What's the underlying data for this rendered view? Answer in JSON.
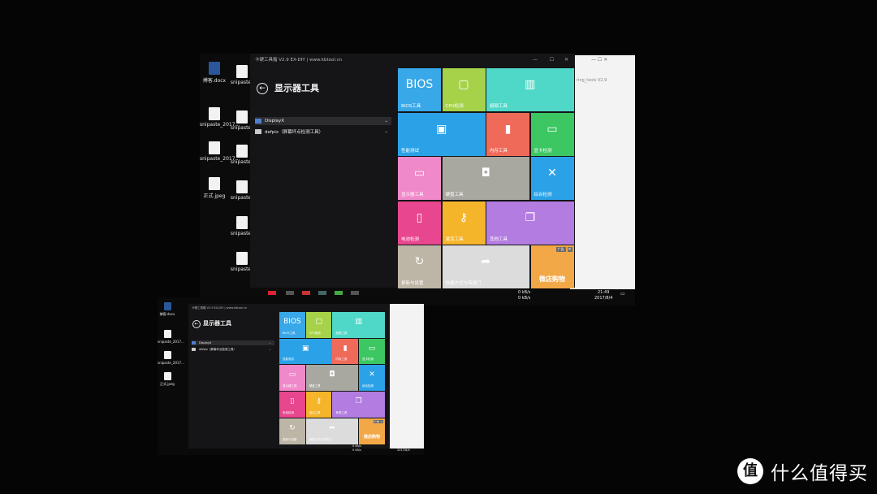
{
  "app": {
    "title": "卡硬工具箱 V2.9  EX-DIY  |  www.kbtool.cn",
    "page_title": "显示器工具",
    "minimize": "—",
    "maximize": "☐",
    "close": "✕",
    "back": "←"
  },
  "tools": [
    {
      "label": "DisplayX",
      "icon": "monitor-icon"
    },
    {
      "label": "defpix（屏幕坏点检测工具）",
      "icon": "pixel-grid-icon"
    }
  ],
  "tiles": [
    {
      "label": "BIOS工具",
      "icon_text": "BIOS",
      "color": "#38a8e8"
    },
    {
      "label": "CPU检测",
      "icon_text": "▢",
      "color": "#a6d24a"
    },
    {
      "label": "超频工具",
      "icon_text": "▥",
      "color": "#4fd8c8"
    },
    {
      "label": "性能测试",
      "icon_text": "▣",
      "color": "#2ba2e8"
    },
    {
      "label": "内存工具",
      "icon_text": "▮",
      "color": "#f06a5a"
    },
    {
      "label": "显卡检测",
      "icon_text": "▭",
      "color": "#3cc763"
    },
    {
      "label": "显示器工具",
      "icon_text": "▭",
      "color": "#f089c9"
    },
    {
      "label": "硬盘工具",
      "icon_text": "◘",
      "color": "#a9a8a0"
    },
    {
      "label": "综合检测",
      "icon_text": "✕",
      "color": "#2ba2e8"
    },
    {
      "label": "电池检测",
      "icon_text": "▯",
      "color": "#e8468e"
    },
    {
      "label": "激活工具",
      "icon_text": "⚷",
      "color": "#f5b52a"
    },
    {
      "label": "其他工具",
      "icon_text": "❐",
      "color": "#b37ce0"
    },
    {
      "label": "更新与设置",
      "icon_text": "↻",
      "color": "#bdb5a6"
    },
    {
      "label": "快捷方式与传送门",
      "icon_text": "➦",
      "color": "#dcdcdc"
    }
  ],
  "ad": {
    "badge": "广告",
    "close": "×",
    "text": "微店购物",
    "color": "#f3a847"
  },
  "desktop": {
    "icons": [
      "搏客.docx",
      "snipaste_2017...",
      "snipaste_2017...",
      "正式.jpeg"
    ],
    "icons2": [
      "snipaste_",
      "snipaste_",
      "snipaste_",
      "snipaste_",
      "snipaste_",
      "snipaste_"
    ]
  },
  "explorer": {
    "path": "ring_tools V2.9"
  },
  "taskbar": {
    "net_up": "0 kB/s",
    "net_down": "0 kB/s",
    "time": "21:49",
    "date": "2017/8/4"
  },
  "watermark": {
    "logo": "值",
    "text": "什么值得买"
  }
}
